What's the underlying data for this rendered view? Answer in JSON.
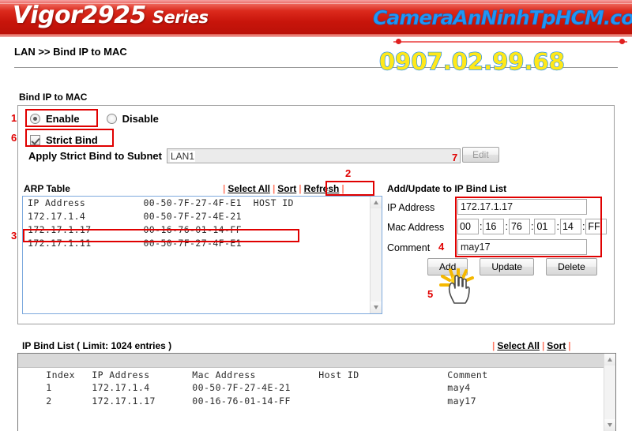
{
  "banner": {
    "logo_main": "Vigor2925",
    "logo_series": "Series"
  },
  "watermark": {
    "site": "CameraAnNinhTpHCM.com",
    "phone": "0907.02.99.68"
  },
  "breadcrumb": "LAN >> Bind IP to MAC",
  "section": {
    "title": "Bind IP to MAC"
  },
  "mode": {
    "enable_label": "Enable",
    "disable_label": "Disable",
    "selected": "Enable"
  },
  "strict_bind": {
    "label": "Strict Bind",
    "checked": true,
    "subnet_label": "Apply Strict Bind to Subnet",
    "subnet_value": "LAN1",
    "edit_button": "Edit"
  },
  "arp": {
    "title": "ARP Table",
    "links": {
      "select_all": "Select All",
      "sort": "Sort",
      "refresh": "Refresh"
    },
    "header": "IP Address          00-50-7F-27-4F-E1  HOST ID",
    "rows": [
      "172.17.1.4          00-50-7F-27-4E-21",
      "172.17.1.17         00-16-76-01-14-FF",
      "172.17.1.11         00-50-7F-27-4F-E1"
    ]
  },
  "form": {
    "title": "Add/Update to IP Bind List",
    "ip_label": "IP Address",
    "ip_value": "172.17.1.17",
    "mac_label": "Mac Address",
    "mac_octets": [
      "00",
      "16",
      "76",
      "01",
      "14",
      "FF"
    ],
    "mac_sep": ":",
    "comment_label": "Comment",
    "comment_value": "may17",
    "buttons": {
      "add": "Add",
      "update": "Update",
      "delete": "Delete"
    }
  },
  "bind_list": {
    "title": "IP Bind List ( Limit: 1024 entries )",
    "links": {
      "select_all": "Select All",
      "sort": "Sort"
    },
    "columns": {
      "index": "Index",
      "ip": "IP Address",
      "mac": "Mac Address",
      "host": "Host ID",
      "comment": "Comment"
    },
    "rows": [
      {
        "index": "1",
        "ip": "172.17.1.4",
        "mac": "00-50-7F-27-4E-21",
        "host": "",
        "comment": "may4"
      },
      {
        "index": "2",
        "ip": "172.17.1.17",
        "mac": "00-16-76-01-14-FF",
        "host": "",
        "comment": "may17"
      }
    ]
  },
  "annotations": {
    "n1": "1",
    "n2": "2",
    "n3": "3",
    "n4": "4",
    "n5": "5",
    "n6": "6",
    "n7": "7"
  },
  "colors": {
    "banner_red": "#c8150b",
    "annotation_red": "#e00000",
    "watermark_blue": "#2196f3",
    "watermark_yellow": "#ffe81a",
    "link_separator": "#ff7a66"
  }
}
